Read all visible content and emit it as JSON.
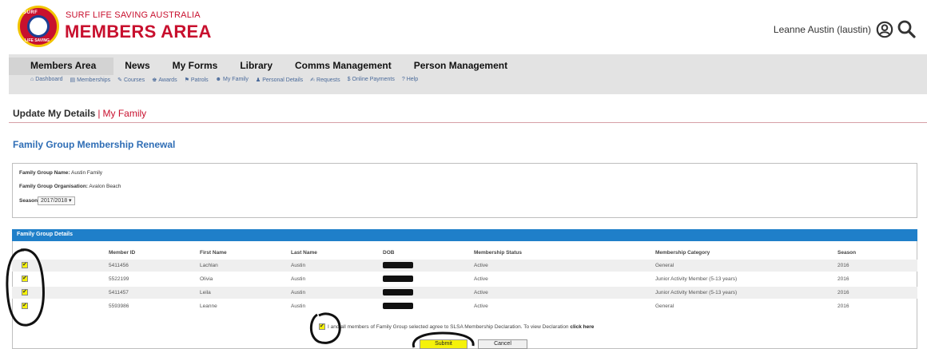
{
  "header": {
    "org_line1": "SURF LIFE SAVING AUSTRALIA",
    "org_line2": "MEMBERS AREA",
    "logo_top": "SURF",
    "logo_bottom": "LIFE SAVING",
    "user_name": "Leanne Austin (laustin)",
    "icons": [
      "user-circle-icon",
      "search-icon"
    ],
    "brand_color": "#c8102e"
  },
  "nav": {
    "main_tabs": [
      {
        "label": "Members Area"
      },
      {
        "label": "News"
      },
      {
        "label": "My Forms"
      },
      {
        "label": "Library"
      },
      {
        "label": "Comms Management"
      },
      {
        "label": "Person Management"
      }
    ],
    "sub_items": [
      {
        "icon": "⌂",
        "label": "Dashboard"
      },
      {
        "icon": "▤",
        "label": "Memberships"
      },
      {
        "icon": "✎",
        "label": "Courses"
      },
      {
        "icon": "♚",
        "label": "Awards"
      },
      {
        "icon": "⚑",
        "label": "Patrols"
      },
      {
        "icon": "☻",
        "label": "My Family"
      },
      {
        "icon": "♟",
        "label": "Personal Details"
      },
      {
        "icon": "✍",
        "label": "Requests"
      },
      {
        "icon": "$",
        "label": "Online Payments"
      },
      {
        "icon": "?",
        "label": "Help"
      }
    ]
  },
  "breadcrumb": {
    "item1": "Update My Details",
    "separator": "|",
    "item2": "My Family"
  },
  "page_title": "Family Group Membership Renewal",
  "family_info": {
    "name_label": "Family Group Name:",
    "name_value": "Austin Family",
    "org_label": "Family Group Organisation:",
    "org_value": "Avalon Beach",
    "season_label": "Season:",
    "season_value": "2017/2018 ▾"
  },
  "table": {
    "section_title": "Family Group Details",
    "columns": [
      "Member ID",
      "First Name",
      "Last Name",
      "DOB",
      "Membership Status",
      "Membership Category",
      "Season"
    ],
    "rows": [
      {
        "member_id": "5411456",
        "first": "Lachlan",
        "last": "Austin",
        "status": "Active",
        "category": "General",
        "season": "2016"
      },
      {
        "member_id": "5522199",
        "first": "Olivia",
        "last": "Austin",
        "status": "Active",
        "category": "Junior Activity Member (5-13 years)",
        "season": "2016"
      },
      {
        "member_id": "5411457",
        "first": "Leila",
        "last": "Austin",
        "status": "Active",
        "category": "Junior Activity Member (5-13 years)",
        "season": "2016"
      },
      {
        "member_id": "5593986",
        "first": "Leanne",
        "last": "Austin",
        "status": "Active",
        "category": "General",
        "season": "2016"
      }
    ]
  },
  "declaration": {
    "text": "I and all members of Family Group selected agree to SLSA Membership Declaration. To view Declaration",
    "link": "click here"
  },
  "buttons": {
    "submit": "Submit",
    "cancel": "Cancel"
  },
  "colors": {
    "accent_blue": "#1f7fc9",
    "title_blue": "#2e6db5",
    "highlight_yellow": "#f5f20a"
  }
}
